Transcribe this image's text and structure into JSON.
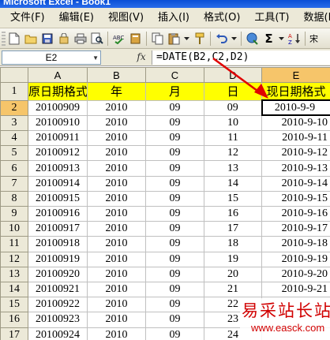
{
  "window": {
    "title": "Microsoft Excel - Book1"
  },
  "menu": [
    "文件(F)",
    "编辑(E)",
    "视图(V)",
    "插入(I)",
    "格式(O)",
    "工具(T)",
    "数据(D)"
  ],
  "toolbar": {
    "font_label": "宋"
  },
  "formula_bar": {
    "name_box": "E2",
    "fx_symbol": "fx",
    "formula": "=DATE(B2,C2,D2)"
  },
  "sheet": {
    "columns": [
      "A",
      "B",
      "C",
      "D",
      "E"
    ],
    "active_column": "E",
    "active_row": 2,
    "header_row": {
      "row": 1,
      "cells": [
        "原日期格式",
        "年",
        "月",
        "日",
        "现日期格式"
      ]
    },
    "rows": [
      {
        "row": 2,
        "cells": [
          "20100909",
          "2010",
          "09",
          "09",
          "2010-9-9"
        ]
      },
      {
        "row": 3,
        "cells": [
          "20100910",
          "2010",
          "09",
          "10",
          "2010-9-10"
        ]
      },
      {
        "row": 4,
        "cells": [
          "20100911",
          "2010",
          "09",
          "11",
          "2010-9-11"
        ]
      },
      {
        "row": 5,
        "cells": [
          "20100912",
          "2010",
          "09",
          "12",
          "2010-9-12"
        ]
      },
      {
        "row": 6,
        "cells": [
          "20100913",
          "2010",
          "09",
          "13",
          "2010-9-13"
        ]
      },
      {
        "row": 7,
        "cells": [
          "20100914",
          "2010",
          "09",
          "14",
          "2010-9-14"
        ]
      },
      {
        "row": 8,
        "cells": [
          "20100915",
          "2010",
          "09",
          "15",
          "2010-9-15"
        ]
      },
      {
        "row": 9,
        "cells": [
          "20100916",
          "2010",
          "09",
          "16",
          "2010-9-16"
        ]
      },
      {
        "row": 10,
        "cells": [
          "20100917",
          "2010",
          "09",
          "17",
          "2010-9-17"
        ]
      },
      {
        "row": 11,
        "cells": [
          "20100918",
          "2010",
          "09",
          "18",
          "2010-9-18"
        ]
      },
      {
        "row": 12,
        "cells": [
          "20100919",
          "2010",
          "09",
          "19",
          "2010-9-19"
        ]
      },
      {
        "row": 13,
        "cells": [
          "20100920",
          "2010",
          "09",
          "20",
          "2010-9-20"
        ]
      },
      {
        "row": 14,
        "cells": [
          "20100921",
          "2010",
          "09",
          "21",
          "2010-9-21"
        ]
      },
      {
        "row": 15,
        "cells": [
          "20100922",
          "2010",
          "09",
          "22",
          ""
        ]
      },
      {
        "row": 16,
        "cells": [
          "20100923",
          "2010",
          "09",
          "23",
          ""
        ]
      },
      {
        "row": 17,
        "cells": [
          "20100924",
          "2010",
          "09",
          "24",
          ""
        ]
      }
    ]
  },
  "watermark": {
    "title": "易采站长站",
    "url": "www.easck.com"
  },
  "colors": {
    "header_fill": "#ffff00",
    "active_header": "#f6c56a",
    "annotation": "#e00000"
  }
}
